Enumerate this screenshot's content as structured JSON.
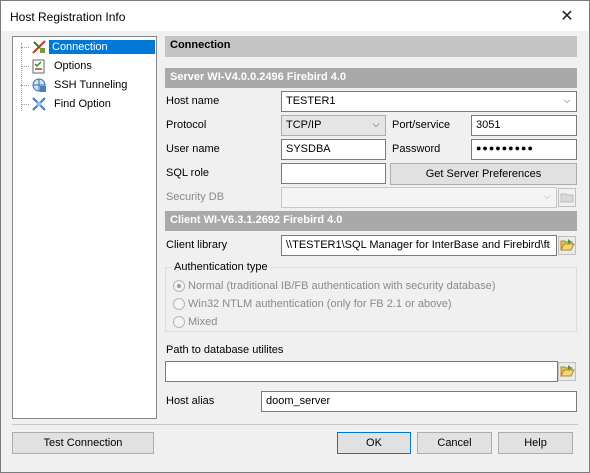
{
  "window": {
    "title": "Host Registration Info",
    "close_glyph": "✕"
  },
  "tree": {
    "items": [
      {
        "label": "Connection",
        "icon": "connection-icon"
      },
      {
        "label": "Options",
        "icon": "options-icon"
      },
      {
        "label": "SSH Tunneling",
        "icon": "ssh-tunneling-icon"
      },
      {
        "label": "Find Option",
        "icon": "find-option-icon"
      }
    ]
  },
  "panel": {
    "title": "Connection",
    "server_header": "Server WI-V4.0.0.2496 Firebird 4.0",
    "client_header": "Client WI-V6.3.1.2692 Firebird 4.0"
  },
  "form": {
    "host_name_label": "Host name",
    "host_name_value": "TESTER1",
    "protocol_label": "Protocol",
    "protocol_value": "TCP/IP",
    "port_label": "Port/service",
    "port_value": "3051",
    "user_name_label": "User name",
    "user_name_value": "SYSDBA",
    "password_label": "Password",
    "password_value": "●●●●●●●●●",
    "sql_role_label": "SQL role",
    "sql_role_value": "",
    "get_server_prefs_label": "Get Server Preferences",
    "security_db_label": "Security DB",
    "security_db_value": "",
    "client_library_label": "Client library",
    "client_library_value": "\\\\TESTER1\\SQL Manager for InterBase and Firebird\\ft",
    "auth_group_label": "Authentication type",
    "auth_options": [
      "Normal (traditional IB/FB authentication with security database)",
      "Win32 NTLM authentication (only for FB 2.1 or above)",
      "Mixed"
    ],
    "path_label": "Path to database utilites",
    "path_value": "",
    "host_alias_label": "Host alias",
    "host_alias_value": "doom_server"
  },
  "buttons": {
    "test_connection": "Test Connection",
    "ok": "OK",
    "cancel": "Cancel",
    "help": "Help"
  },
  "colors": {
    "selection": "#0078d7",
    "header_dark": "#a9a9a9",
    "header_light": "#c4c4c4"
  }
}
